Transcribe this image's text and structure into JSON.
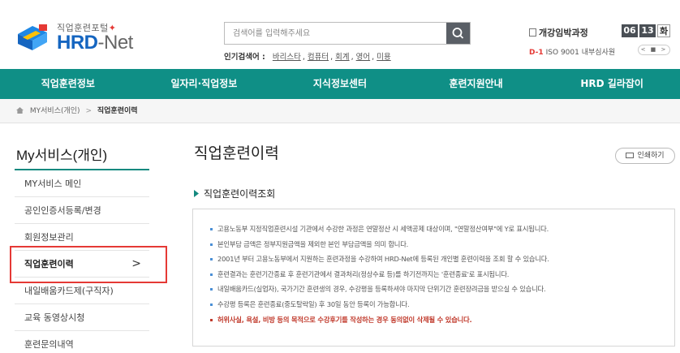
{
  "header": {
    "logo_sub": "직업훈련포털",
    "logo_star": "✦",
    "logo_main_hrd": "HRD",
    "logo_main_net": "-Net",
    "search_placeholder": "검색어를 입력해주세요",
    "popular_label": "인기검색어 :",
    "popular_keywords": [
      "바리스타",
      "컴퓨터",
      "회계",
      "영어",
      "미용"
    ],
    "side_title": "개강임박과정",
    "date_month": "06",
    "date_day": "13",
    "date_weekday": "화",
    "course_dday": "D-1",
    "course_name": "ISO 9001 내부심사원",
    "pager_text": "<  ■  >"
  },
  "nav": {
    "items": [
      "직업훈련정보",
      "일자리·직업정보",
      "지식정보센터",
      "훈련지원안내",
      "HRD 길라잡이"
    ]
  },
  "breadcrumb": {
    "parent": "MY서비스(개인)",
    "separator": ">",
    "current": "직업훈련이력"
  },
  "sidebar": {
    "title": "My서비스(개인)",
    "items": [
      {
        "label": "MY서비스 메인"
      },
      {
        "label": "공인인증서등록/변경"
      },
      {
        "label": "회원정보관리"
      },
      {
        "label": "직업훈련이력"
      },
      {
        "label": "내일배움카드제(구직자)"
      },
      {
        "label": "교육 동영상시청"
      },
      {
        "label": "훈련문의내역"
      }
    ],
    "active_arrow": ">"
  },
  "main": {
    "title": "직업훈련이력",
    "print_label": "인쇄하기",
    "section_title": "직업훈련이력조회",
    "notices": [
      "고용노동부 지정직업훈련시설 기관에서 수강한 과정은 연말정산 시 세액공제 대상이며, \"연말정산여부\"에 Y로 표시됩니다.",
      "본인부담 금액은 정부지원금액을 제외한 본인 부담금액을 의미 합니다.",
      "2001년 부터 고용노동부에서 지원하는 훈련과정을 수강하여 HRD-Net에 등록된 개인별 훈련이력을 조회 할 수 있습니다.",
      "훈련결과는 훈련기간종료 후 훈련기관에서 결과처리(정상수료 등)를 하기전까지는 '훈련종료'로 표시됩니다.",
      "내일배움카드(실업자), 국가기간 훈련생의 경우, 수강평을 등록하셔야 마지막 단위기간 훈련장려금을 받으실 수 있습니다.",
      "수강평 등록은 훈련종료(중도탈락일) 후 30일 동안 등록이 가능합니다.",
      "허위사실, 욕설, 비방 등의 목적으로 수강후기를 작성하는 경우 동의없이 삭제될 수 있습니다."
    ]
  },
  "colors": {
    "nav_bg": "#0f8f86",
    "brand_blue": "#1565c0",
    "highlight_red": "#e53935",
    "warning_red": "#c0392b"
  }
}
